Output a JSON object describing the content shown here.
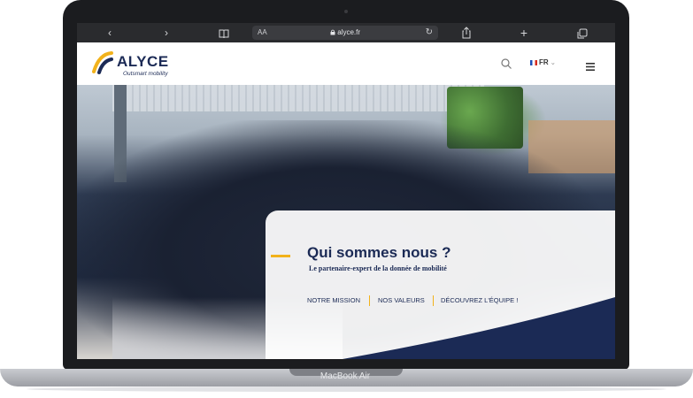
{
  "browser": {
    "url_prefix": "AA",
    "url": "alyce.fr",
    "icons": [
      "chevron-left-icon",
      "chevron-right-icon",
      "book-icon",
      "share-icon",
      "plus-icon",
      "tabs-icon",
      "reload-icon",
      "lock-icon"
    ]
  },
  "header": {
    "logo_text": "ALYCE",
    "logo_tagline": "Outsmart mobility",
    "language": "FR"
  },
  "hero": {
    "title": "Qui sommes nous ?",
    "subtitle": "Le partenaire-expert de la donnée de mobilité",
    "links": [
      "NOTRE MISSION",
      "NOS VALEURS",
      "DÉCOUVREZ L'ÉQUIPE !"
    ]
  },
  "device": {
    "label": "MacBook Air"
  },
  "colors": {
    "brand_navy": "#1b2a55",
    "accent_yellow": "#f2b21b"
  }
}
